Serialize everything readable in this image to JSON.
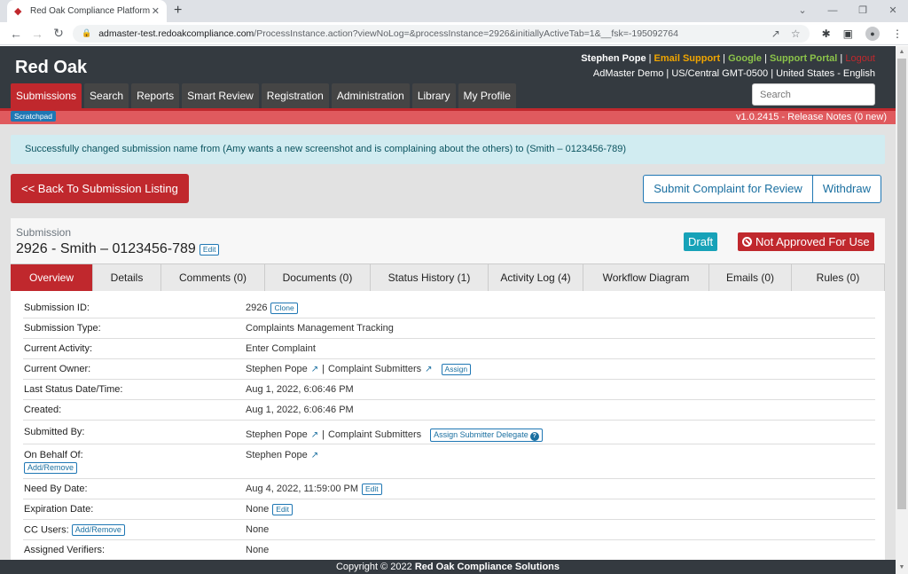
{
  "browser": {
    "tab_title": "Red Oak Compliance Platform",
    "url_host": "admaster-test.redoakcompliance.com",
    "url_path": "/ProcessInstance.action?viewNoLog=&processInstance=2926&initiallyActiveTab=1&__fsk=-195092764"
  },
  "header": {
    "brand": "Red Oak",
    "user_name": "Stephen Pope",
    "email_support": "Email Support",
    "google": "Google",
    "support_portal": "Support Portal",
    "logout": "Logout",
    "separator": " | ",
    "locale": "AdMaster Demo | US/Central GMT-0500 | United States - English",
    "search_placeholder": "Search",
    "nav": [
      {
        "label": "Submissions",
        "active": true
      },
      {
        "label": "Search"
      },
      {
        "label": "Reports"
      },
      {
        "label": "Smart Review"
      },
      {
        "label": "Registration"
      },
      {
        "label": "Administration"
      },
      {
        "label": "Library"
      },
      {
        "label": "My Profile"
      }
    ],
    "scratchpad": "Scratchpad",
    "version": "v1.0.2415 -  Release Notes (0 new)"
  },
  "alert": "Successfully changed submission name from (Amy wants a new screenshot and is complaining about the others) to (Smith – 0123456-789)",
  "actions": {
    "back": "<< Back To Submission Listing",
    "submit": "Submit Complaint for Review",
    "withdraw": "Withdraw"
  },
  "submission": {
    "label": "Submission",
    "title": "2926 - Smith – 0123456-789",
    "edit": "Edit",
    "status": "Draft",
    "approval": "Not Approved For Use",
    "colors": {
      "accent_red": "#c0282d",
      "draft_teal": "#17a2b8",
      "link_blue": "#1a6fa0"
    }
  },
  "tabs": [
    {
      "label": "Overview",
      "active": true
    },
    {
      "label": "Details"
    },
    {
      "label": "Comments (0)"
    },
    {
      "label": "Documents (0)"
    },
    {
      "label": "Status History (1)"
    },
    {
      "label": "Activity Log (4)"
    },
    {
      "label": "Workflow Diagram"
    },
    {
      "label": "Emails (0)"
    },
    {
      "label": "Rules (0)"
    }
  ],
  "overview": {
    "submission_id": {
      "label": "Submission ID:",
      "value": "2926",
      "button": "Clone"
    },
    "submission_type": {
      "label": "Submission Type:",
      "value": "Complaints Management Tracking"
    },
    "current_activity": {
      "label": "Current Activity:",
      "value": "Enter Complaint"
    },
    "current_owner": {
      "label": "Current Owner:",
      "user": "Stephen Pope",
      "group": "Complaint Submitters",
      "button": "Assign"
    },
    "last_status": {
      "label": "Last Status Date/Time:",
      "value": "Aug 1, 2022, 6:06:46 PM"
    },
    "created": {
      "label": "Created:",
      "value": "Aug 1, 2022, 6:06:46 PM"
    },
    "submitted_by": {
      "label": "Submitted By:",
      "user": "Stephen Pope",
      "group": "Complaint Submitters",
      "button": "Assign Submitter Delegate"
    },
    "on_behalf_of": {
      "label": "On Behalf Of:",
      "button": "Add/Remove",
      "user": "Stephen Pope"
    },
    "need_by": {
      "label": "Need By Date:",
      "value": "Aug 4, 2022, 11:59:00 PM",
      "button": "Edit"
    },
    "expiration": {
      "label": "Expiration Date:",
      "value": "None",
      "button": "Edit"
    },
    "cc_users": {
      "label": "CC Users:",
      "button": "Add/Remove",
      "value": "None"
    },
    "assigned_verifiers": {
      "label": "Assigned Verifiers:",
      "value": "None"
    }
  },
  "footer": {
    "prefix": "Copyright © 2022 ",
    "company": "Red Oak Compliance Solutions"
  }
}
